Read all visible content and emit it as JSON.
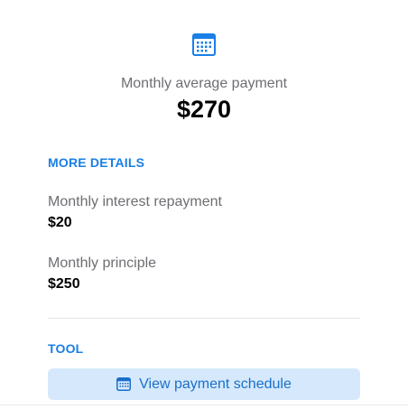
{
  "summary": {
    "label": "Monthly average payment",
    "value": "$270"
  },
  "more_details": {
    "heading": "MORE DETAILS",
    "items": [
      {
        "label": "Monthly interest repayment",
        "value": "$20"
      },
      {
        "label": "Monthly principle",
        "value": "$250"
      }
    ]
  },
  "tool": {
    "heading": "TOOL",
    "button_label": "View payment schedule"
  },
  "icons": {
    "header": "calendar-icon",
    "button": "calendar-icon"
  },
  "colors": {
    "accent": "#1a7fe6",
    "button_bg": "#d6e9fc",
    "muted_text": "#6e6e73"
  }
}
